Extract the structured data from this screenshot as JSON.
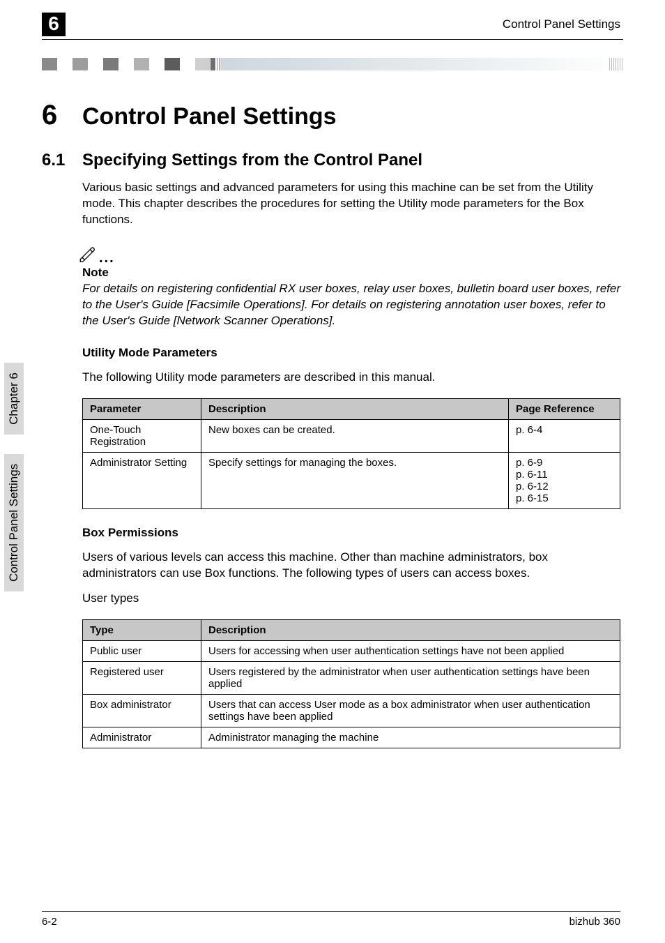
{
  "running_head": {
    "chapter_badge": "6",
    "title": "Control Panel Settings"
  },
  "chapter_title": {
    "num": "6",
    "text": "Control Panel Settings"
  },
  "section_title": {
    "num": "6.1",
    "text": "Specifying Settings from the Control Panel"
  },
  "intro_para": "Various basic settings and advanced parameters for using this machine can be set from the Utility mode. This chapter describes the procedures for setting the Utility mode parameters for the Box functions.",
  "note": {
    "label": "Note",
    "body": "For details on registering confidential RX user boxes, relay user boxes, bulletin board user boxes, refer to the User's Guide [Facsimile Operations]. For details on registering annotation user boxes, refer to the User's Guide [Network Scanner Operations]."
  },
  "util_heading": "Utility Mode Parameters",
  "util_intro": "The following Utility mode parameters are described in this manual.",
  "util_table": {
    "headers": [
      "Parameter",
      "Description",
      "Page Reference"
    ],
    "rows": [
      {
        "c0": "One-Touch Registration",
        "c1": "New boxes can be created.",
        "c2": "p. 6-4"
      },
      {
        "c0": "Administrator Setting",
        "c1": "Specify settings for managing the boxes.",
        "c2": "p. 6-9\np. 6-11\np. 6-12\np. 6-15"
      }
    ]
  },
  "box_heading": "Box Permissions",
  "box_intro": "Users of various levels can access this machine. Other than machine administrators, box administrators can use Box functions. The following types of users can access boxes.",
  "user_types_label": "User types",
  "box_table": {
    "headers": [
      "Type",
      "Description"
    ],
    "rows": [
      {
        "c0": "Public user",
        "c1": "Users for accessing when user authentication settings have not been applied"
      },
      {
        "c0": "Registered user",
        "c1": "Users registered by the administrator when user authentication settings have been applied"
      },
      {
        "c0": "Box administrator",
        "c1": "Users that can access User mode as a box administrator when user authentication settings have been applied"
      },
      {
        "c0": "Administrator",
        "c1": "Administrator managing the machine"
      }
    ]
  },
  "side_tab": {
    "group1": "Control Panel Settings",
    "group2": "Chapter 6"
  },
  "footer": {
    "left": "6-2",
    "right": "bizhub 360"
  }
}
